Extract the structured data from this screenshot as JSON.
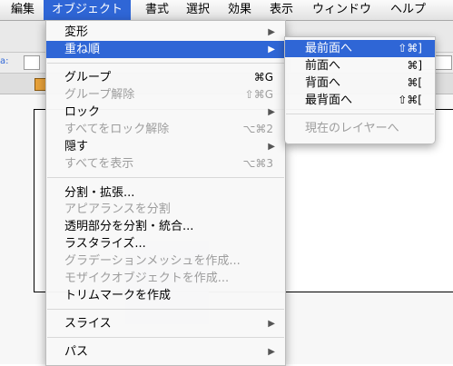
{
  "menubar": {
    "items": [
      {
        "label": "編集"
      },
      {
        "label": "オブジェクト"
      },
      {
        "label": "書式"
      },
      {
        "label": "選択"
      },
      {
        "label": "効果"
      },
      {
        "label": "表示"
      },
      {
        "label": "ウィンドウ"
      },
      {
        "label": "ヘルプ"
      }
    ],
    "active_index": 1
  },
  "object_menu": {
    "items": [
      {
        "label": "変形",
        "shortcut": "",
        "submenu": true,
        "enabled": true
      },
      {
        "label": "重ね順",
        "shortcut": "",
        "submenu": true,
        "enabled": true,
        "highlighted": true
      },
      {
        "label": "グループ",
        "shortcut": "⌘G",
        "submenu": false,
        "enabled": true
      },
      {
        "label": "グループ解除",
        "shortcut": "⇧⌘G",
        "submenu": false,
        "enabled": false
      },
      {
        "label": "ロック",
        "shortcut": "",
        "submenu": true,
        "enabled": true
      },
      {
        "label": "すべてをロック解除",
        "shortcut": "⌥⌘2",
        "submenu": false,
        "enabled": false
      },
      {
        "label": "隠す",
        "shortcut": "",
        "submenu": true,
        "enabled": true
      },
      {
        "label": "すべてを表示",
        "shortcut": "⌥⌘3",
        "submenu": false,
        "enabled": false
      },
      {
        "label": "分割・拡張...",
        "shortcut": "",
        "submenu": false,
        "enabled": true
      },
      {
        "label": "アピアランスを分割",
        "shortcut": "",
        "submenu": false,
        "enabled": false
      },
      {
        "label": "透明部分を分割・統合...",
        "shortcut": "",
        "submenu": false,
        "enabled": true
      },
      {
        "label": "ラスタライズ...",
        "shortcut": "",
        "submenu": false,
        "enabled": true
      },
      {
        "label": "グラデーションメッシュを作成...",
        "shortcut": "",
        "submenu": false,
        "enabled": false
      },
      {
        "label": "モザイクオブジェクトを作成...",
        "shortcut": "",
        "submenu": false,
        "enabled": false
      },
      {
        "label": "トリムマークを作成",
        "shortcut": "",
        "submenu": false,
        "enabled": true
      },
      {
        "label": "スライス",
        "shortcut": "",
        "submenu": true,
        "enabled": true
      },
      {
        "label": "パス",
        "shortcut": "",
        "submenu": true,
        "enabled": true
      }
    ]
  },
  "arrange_submenu": {
    "items": [
      {
        "label": "最前面へ",
        "shortcut": "⇧⌘]",
        "enabled": true,
        "highlighted": true
      },
      {
        "label": "前面へ",
        "shortcut": "⌘]",
        "enabled": true
      },
      {
        "label": "背面へ",
        "shortcut": "⌘[",
        "enabled": true
      },
      {
        "label": "最背面へ",
        "shortcut": "⇧⌘[",
        "enabled": true
      },
      {
        "label": "現在のレイヤーへ",
        "shortcut": "",
        "enabled": false
      }
    ]
  },
  "colors": {
    "highlight": "#2f66d6",
    "disabled_text": "#9d9d9d"
  },
  "icons": {
    "submenu_arrow": "triangle-right-icon"
  }
}
